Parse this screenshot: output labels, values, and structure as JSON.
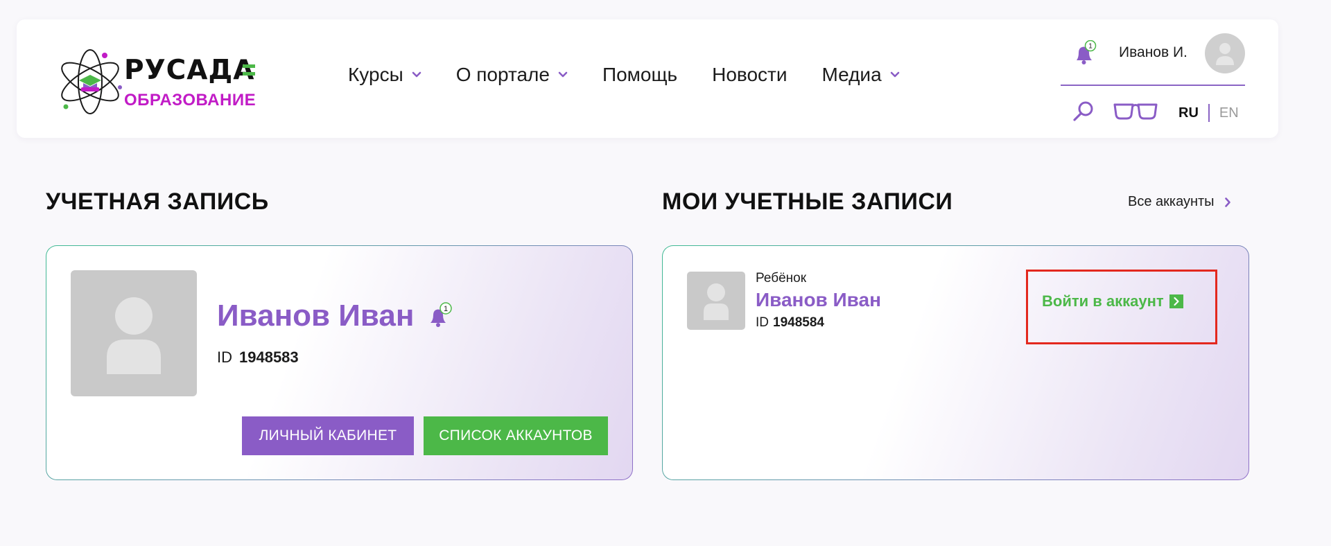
{
  "logo": {
    "word": "РУСАДА",
    "subtitle": "ОБРАЗОВАНИЕ"
  },
  "nav": [
    {
      "label": "Курсы",
      "dropdown": true
    },
    {
      "label": "О портале",
      "dropdown": true
    },
    {
      "label": "Помощь",
      "dropdown": false
    },
    {
      "label": "Новости",
      "dropdown": false
    },
    {
      "label": "Медиа",
      "dropdown": true
    }
  ],
  "header": {
    "notification_count": "1",
    "user_short_name": "Иванов И.",
    "lang_ru": "RU",
    "lang_en": "EN"
  },
  "account": {
    "section_title": "УЧЕТНАЯ ЗАПИСЬ",
    "name": "Иванов Иван",
    "notification_count": "1",
    "id_label": "ID",
    "id_value": "1948583",
    "btn_cabinet": "ЛИЧНЫЙ КАБИНЕТ",
    "btn_accounts": "СПИСОК АККАУНТОВ"
  },
  "my_accounts": {
    "section_title": "МОИ УЧЕТНЫЕ ЗАПИСИ",
    "all_link": "Все аккаунты",
    "items": [
      {
        "role": "Ребёнок",
        "name": "Иванов Иван",
        "id_label": "ID",
        "id_value": "1948584",
        "login_label": "Войти в аккаунт"
      }
    ]
  },
  "colors": {
    "brand_purple": "#8a5cc6",
    "brand_green": "#4cb848",
    "brand_magenta": "#c11bc6",
    "highlight_red": "#e3281e"
  }
}
